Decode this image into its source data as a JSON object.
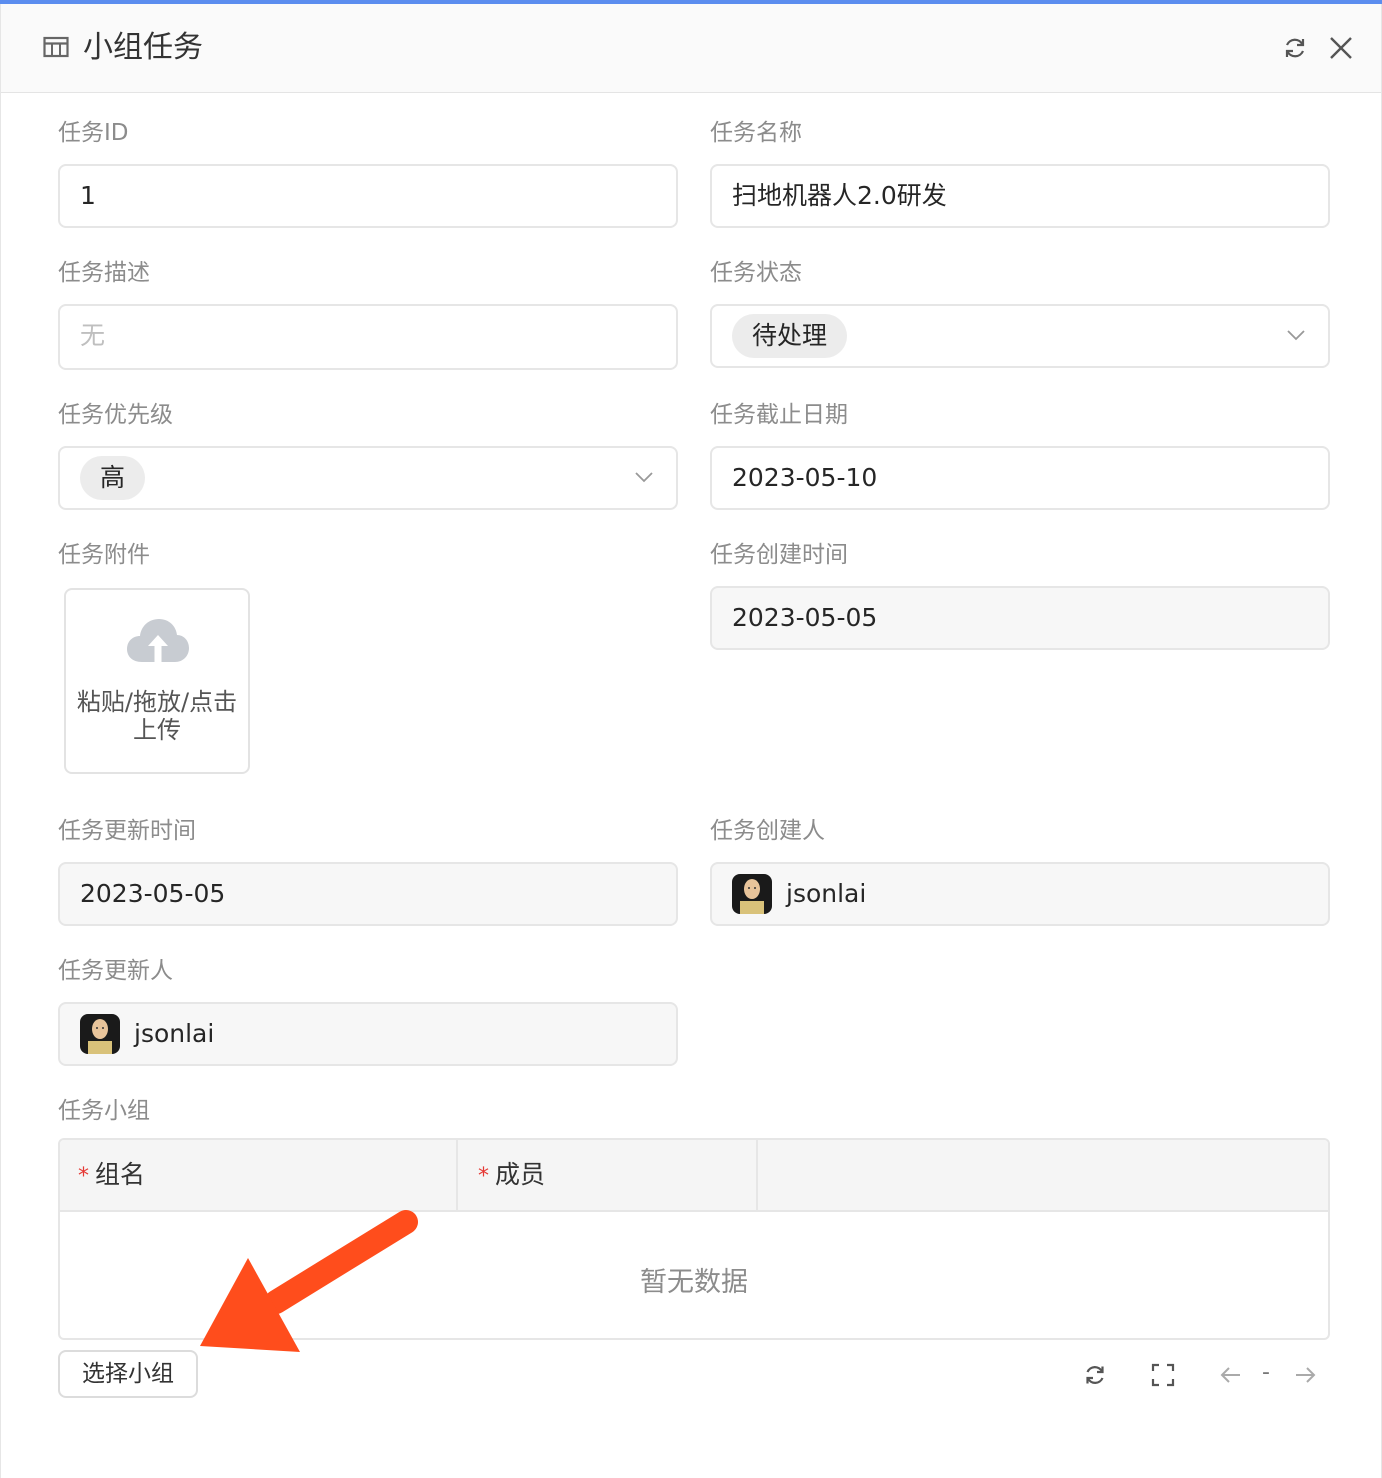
{
  "dialog": {
    "title": "小组任务",
    "icons": {
      "title": "table-icon",
      "refresh": "refresh-icon",
      "close": "close-icon"
    }
  },
  "form": {
    "task_id": {
      "label": "任务ID",
      "value": "1"
    },
    "task_name": {
      "label": "任务名称",
      "value": "扫地机器人2.0研发"
    },
    "task_desc": {
      "label": "任务描述",
      "placeholder": "无"
    },
    "task_status": {
      "label": "任务状态",
      "value": "待处理"
    },
    "task_priority": {
      "label": "任务优先级",
      "value": "高"
    },
    "task_deadline": {
      "label": "任务截止日期",
      "value": "2023-05-10"
    },
    "task_attachment": {
      "label": "任务附件",
      "upload_text": "粘贴/拖放/点击上传"
    },
    "task_created_at": {
      "label": "任务创建时间",
      "value": "2023-05-05"
    },
    "task_updated_at": {
      "label": "任务更新时间",
      "value": "2023-05-05"
    },
    "task_creator": {
      "label": "任务创建人",
      "value": "jsonlai"
    },
    "task_updater": {
      "label": "任务更新人",
      "value": "jsonlai"
    }
  },
  "groups": {
    "label": "任务小组",
    "columns": [
      {
        "label": "组名",
        "required_mark": "*"
      },
      {
        "label": "成员",
        "required_mark": "*"
      }
    ],
    "empty_text": "暂无数据",
    "select_button": "选择小组",
    "pagination": {
      "separator": "-"
    }
  },
  "colors": {
    "accent_top": "#5b8def",
    "annotation_arrow": "#ff4d1c",
    "required": "#e53935"
  }
}
